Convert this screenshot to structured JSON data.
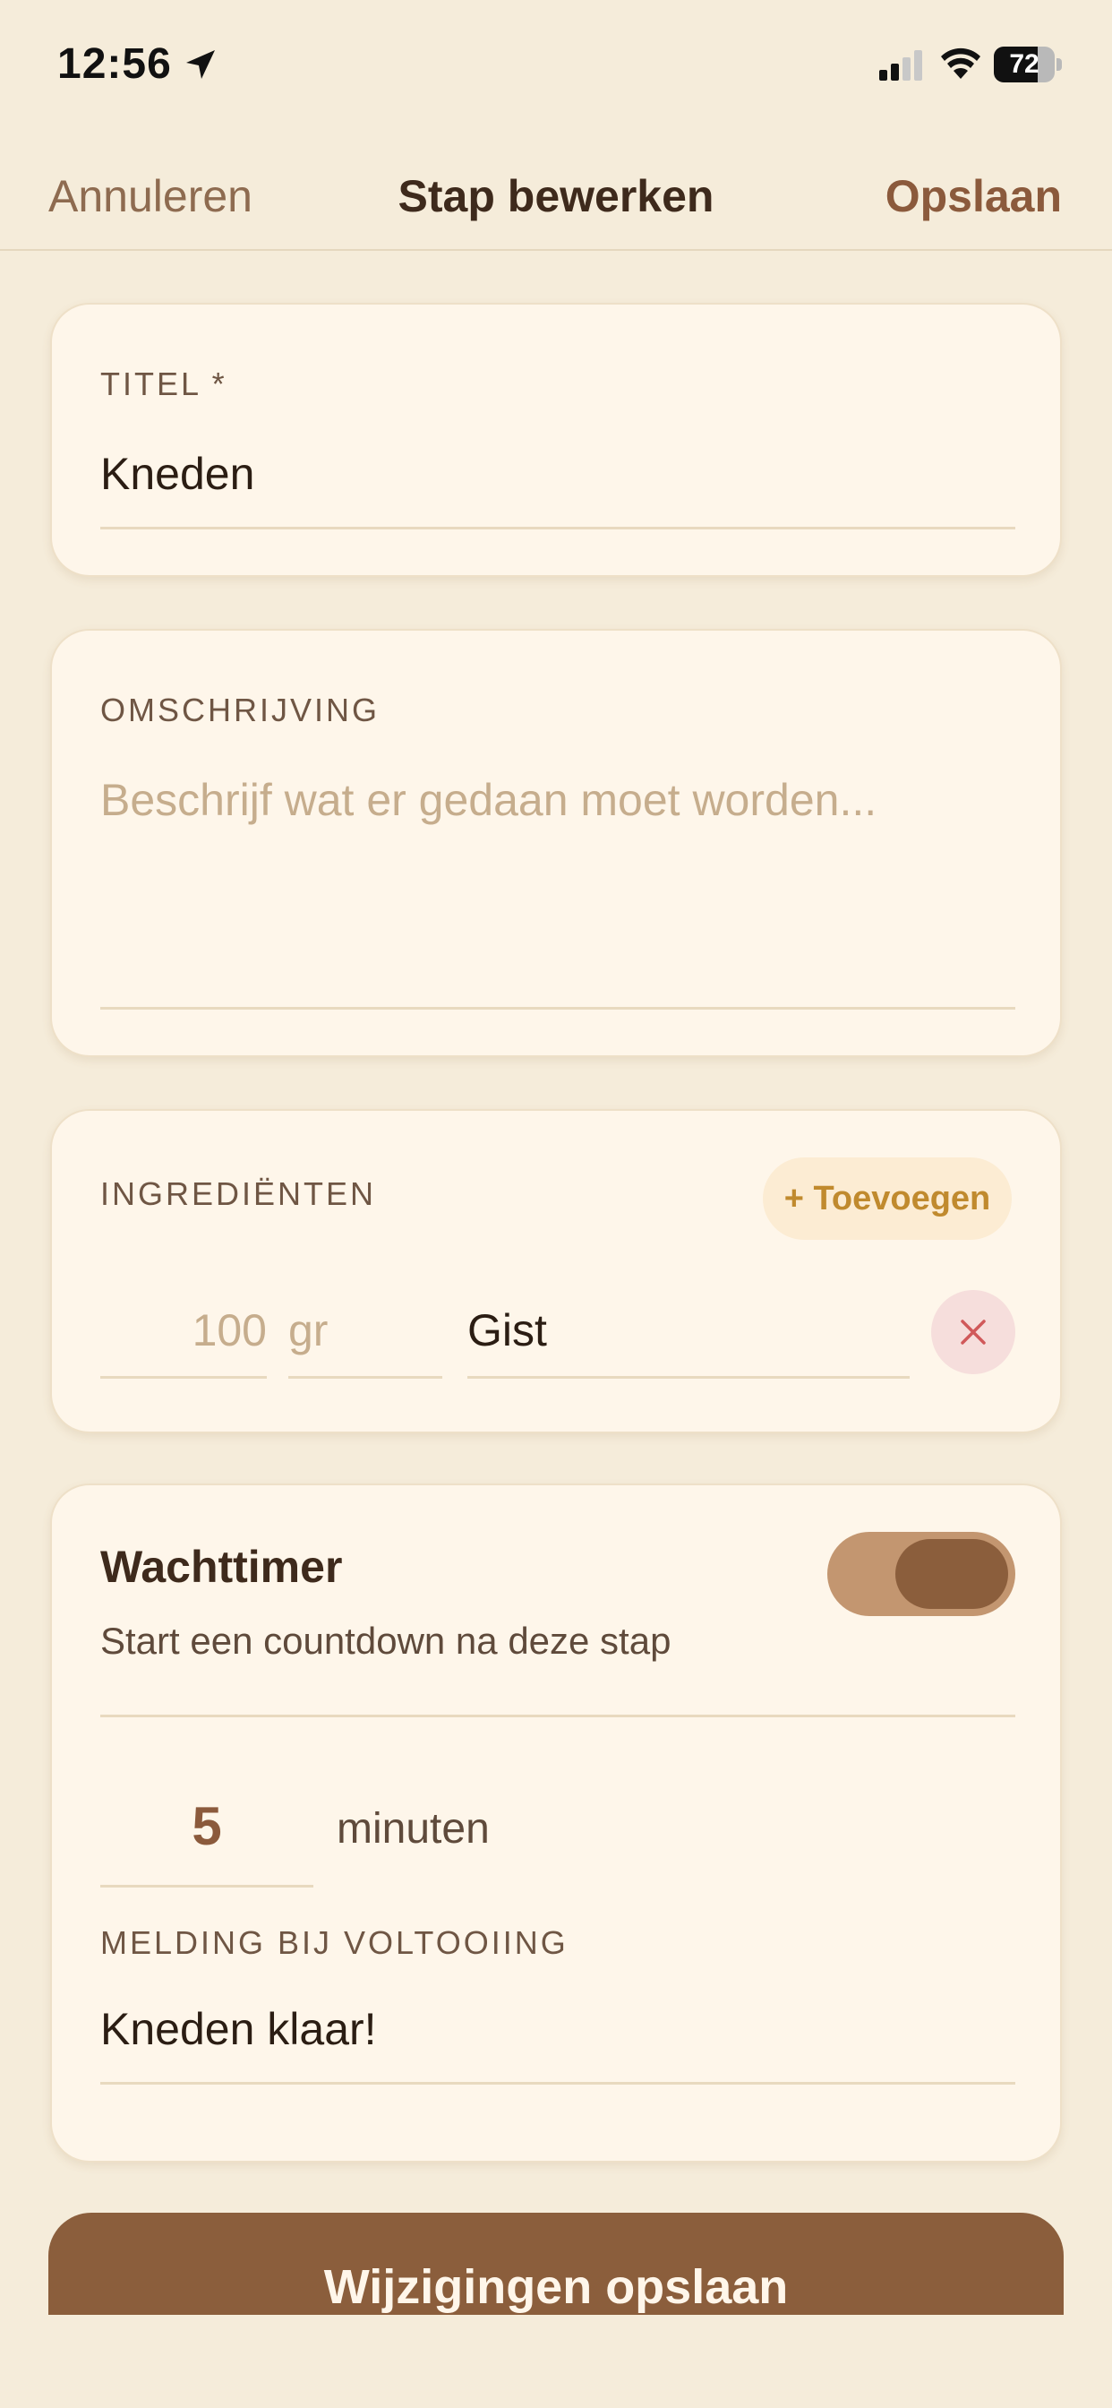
{
  "status_bar": {
    "time": "12:56",
    "battery": "72",
    "battery_level": 0.72,
    "icons": [
      "location-arrow-icon",
      "signal-icon",
      "wifi-icon",
      "battery-icon"
    ]
  },
  "nav": {
    "cancel": "Annuleren",
    "title": "Stap bewerken",
    "save": "Opslaan"
  },
  "title_field": {
    "label": "TITEL *",
    "value": "Kneden"
  },
  "description_field": {
    "label": "OMSCHRIJVING",
    "placeholder": "Beschrijf wat er gedaan moet worden..."
  },
  "ingredients": {
    "label": "INGREDIËNTEN",
    "add_button": "+ Toevoegen",
    "items": [
      {
        "amount_placeholder": "100",
        "unit_placeholder": "gr",
        "name": "Gist"
      }
    ]
  },
  "timer": {
    "title": "Wachttimer",
    "subtitle": "Start een countdown na deze stap",
    "enabled": true,
    "minutes": "5",
    "minutes_unit": "minuten",
    "notification_label": "MELDING BIJ VOLTOOIING",
    "notification_value": "Kneden klaar!"
  },
  "primary_button": "Wijzigingen opslaan",
  "colors": {
    "background": "#F5ECDA",
    "card": "#FEF6EA",
    "accent_brown": "#8B5E3C",
    "toggle_track": "#C39670",
    "add_button_text": "#C08A2E",
    "remove_button_bg": "#F6DEDC",
    "remove_icon": "#D0595A"
  }
}
